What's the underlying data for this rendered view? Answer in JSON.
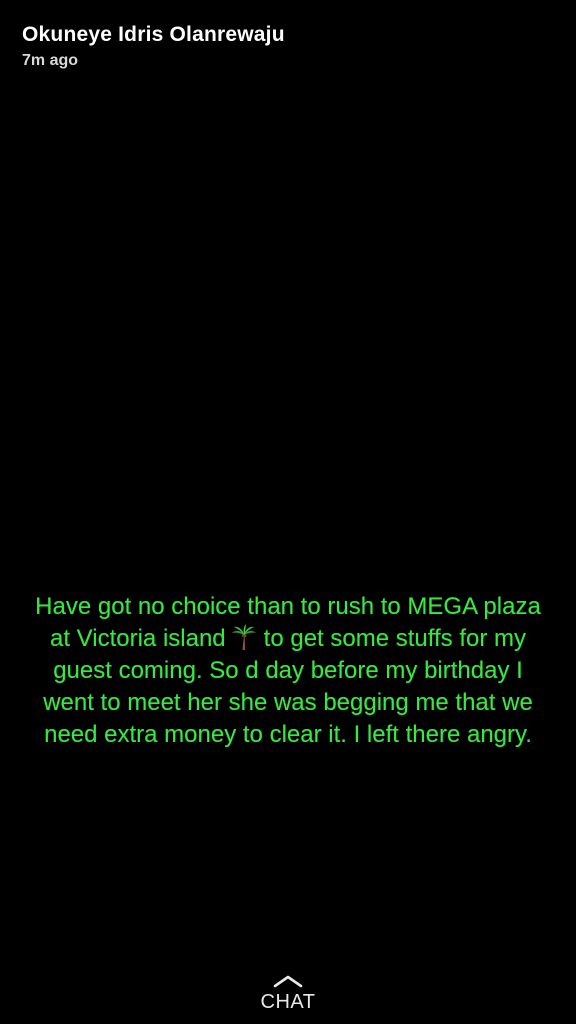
{
  "story": {
    "sender_name": "Okuneye Idris Olanrewaju",
    "timestamp": "7m ago",
    "caption": {
      "color": "#39e843",
      "line1": "Have got no choice than to rush to MEGA plaza",
      "line2_before_emoji": "at Victoria island",
      "emoji": "palm-tree-icon",
      "line2_after_emoji": "to get some stuffs for my",
      "line3": "guest coming. So d day before my birthday I",
      "line4": "went to meet her she was begging me that we",
      "line5": "need extra money to clear it. I left there angry."
    }
  },
  "footer": {
    "chat_label": "CHAT",
    "chat_icon": "chevron-up-icon"
  },
  "colors": {
    "background": "#000000",
    "caption_text": "#39e843",
    "header_text": "#ffffff"
  }
}
